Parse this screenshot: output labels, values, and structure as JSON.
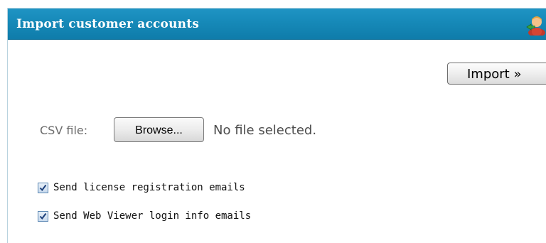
{
  "panel": {
    "title": "Import customer accounts",
    "header_icon": "user-import-icon"
  },
  "toolbar": {
    "import_label": "Import »"
  },
  "csv": {
    "label": "CSV file:",
    "browse_label": "Browse...",
    "file_status": "No file selected."
  },
  "options": [
    {
      "label": "Send license registration emails",
      "checked": true
    },
    {
      "label": "Send Web Viewer login info emails",
      "checked": true
    }
  ],
  "colors": {
    "header_bg": "#1689b8",
    "header_text": "#ffffff",
    "checkbox_border": "#5b87b3"
  }
}
